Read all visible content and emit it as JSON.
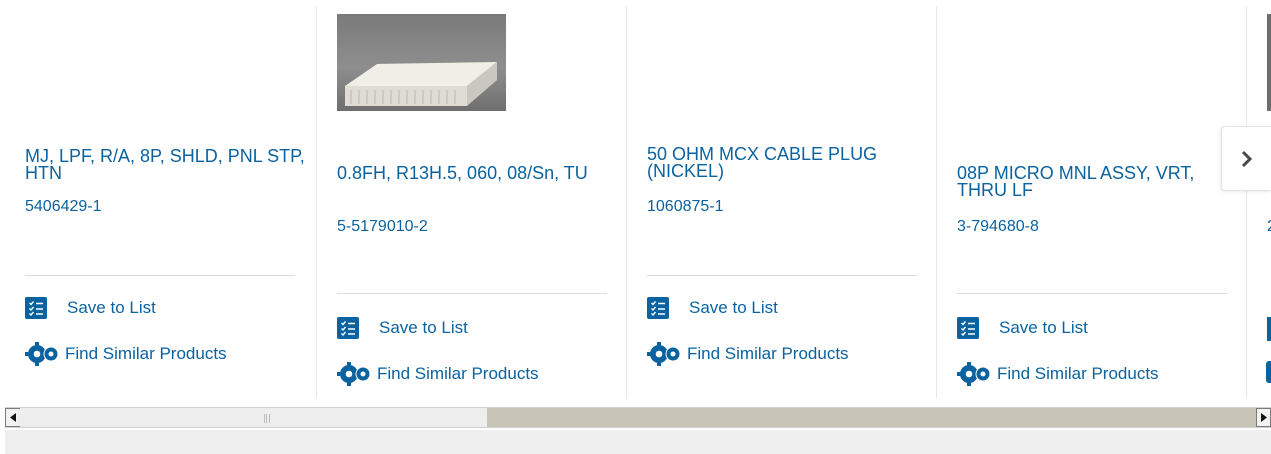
{
  "colors": {
    "link": "#0b62a0",
    "divider": "#e6e6e6",
    "scroll_track": "#c8c4b6"
  },
  "products": [
    {
      "title": "MJ, LPF, R/A, 8P, SHLD, PNL STP, HTN",
      "part_number": "5406429-1",
      "save_label": "Save to List",
      "similar_label": "Find Similar Products",
      "has_image": false
    },
    {
      "title": "0.8FH, R13H.5, 060, 08/Sn, TU",
      "part_number": "5-5179010-2",
      "save_label": "Save to List",
      "similar_label": "Find Similar Products",
      "has_image": true
    },
    {
      "title": "50 OHM MCX CABLE PLUG (NICKEL)",
      "part_number": "1060875-1",
      "save_label": "Save to List",
      "similar_label": "Find Similar Products",
      "has_image": false
    },
    {
      "title": "08P MICRO MNL ASSY, VRT, THRU LF",
      "part_number": "3-794680-8",
      "save_label": "Save to List",
      "similar_label": "Find Similar Products",
      "has_image": false
    },
    {
      "part_number_partial": "2"
    }
  ],
  "carousel": {
    "next_icon": "chevron-right-icon"
  },
  "scrollbar": {
    "left_icon": "arrow-left-icon",
    "right_icon": "arrow-right-icon"
  }
}
